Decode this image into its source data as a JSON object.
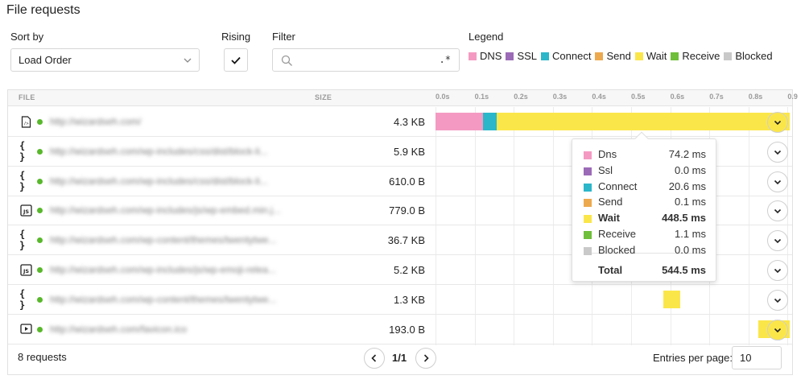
{
  "page": {
    "title": "File requests"
  },
  "controls": {
    "sort_label": "Sort by",
    "sort_value": "Load Order",
    "rising_label": "Rising",
    "filter_label": "Filter",
    "filter_value": "",
    "regex_glyph": ".*",
    "legend_label": "Legend"
  },
  "legend": [
    {
      "name": "DNS",
      "color": "#f49ac2"
    },
    {
      "name": "SSL",
      "color": "#9b6bb7"
    },
    {
      "name": "Connect",
      "color": "#2bb6c9"
    },
    {
      "name": "Send",
      "color": "#eda94e"
    },
    {
      "name": "Wait",
      "color": "#fbe64a"
    },
    {
      "name": "Receive",
      "color": "#6fbf3a"
    },
    {
      "name": "Blocked",
      "color": "#c9c9c9"
    }
  ],
  "table": {
    "col_file": "FILE",
    "col_size": "SIZE",
    "ticks": [
      "0.0s",
      "0.1s",
      "0.2s",
      "0.3s",
      "0.4s",
      "0.5s",
      "0.6s",
      "0.7s",
      "0.8s",
      "0.9"
    ],
    "rows": [
      {
        "icon": "document-code-icon",
        "status": "green",
        "url": "http://wizardseh.com/",
        "size": "4.3 KB",
        "segments": [
          {
            "phase": "DNS",
            "start": 0.0,
            "end": 0.122
          },
          {
            "phase": "Connect",
            "start": 0.122,
            "end": 0.157
          },
          {
            "phase": "Wait",
            "start": 0.157,
            "end": 0.905
          }
        ],
        "expanded": true
      },
      {
        "icon": "braces-icon",
        "status": "green",
        "url": "http://wizardseh.com/wp-includes/css/dist/block-li...",
        "size": "5.9 KB",
        "segments": [],
        "expanded": false
      },
      {
        "icon": "braces-icon",
        "status": "green",
        "url": "http://wizardseh.com/wp-includes/css/dist/block-li...",
        "size": "610.0 B",
        "segments": [],
        "expanded": false
      },
      {
        "icon": "js-file-icon",
        "status": "green",
        "url": "http://wizardseh.com/wp-includes/js/wp-embed.min.j...",
        "size": "779.0 B",
        "segments": [],
        "expanded": false
      },
      {
        "icon": "braces-icon",
        "status": "green",
        "url": "http://wizardseh.com/wp-content/themes/twentytwe...",
        "size": "36.7 KB",
        "segments": [],
        "expanded": false
      },
      {
        "icon": "js-file-icon",
        "status": "green",
        "url": "http://wizardseh.com/wp-includes/js/wp-emoji-relea...",
        "size": "5.2 KB",
        "segments": [],
        "expanded": false
      },
      {
        "icon": "braces-icon",
        "status": "green",
        "url": "http://wizardseh.com/wp-content/themes/twentytwe...",
        "size": "1.3 KB",
        "segments": [
          {
            "phase": "Wait",
            "start": 0.583,
            "end": 0.626
          }
        ],
        "expanded": false
      },
      {
        "icon": "media-play-icon",
        "status": "green",
        "url": "http://wizardseh.com/favicon.ico",
        "size": "193.0 B",
        "segments": [
          {
            "phase": "Wait",
            "start": 0.826,
            "end": 0.905
          }
        ],
        "expanded": true
      }
    ]
  },
  "tooltip": {
    "rows": [
      {
        "name": "Dns",
        "value": "74.2 ms",
        "color": "#f49ac2",
        "bold": false
      },
      {
        "name": "Ssl",
        "value": "0.0 ms",
        "color": "#9b6bb7",
        "bold": false
      },
      {
        "name": "Connect",
        "value": "20.6 ms",
        "color": "#2bb6c9",
        "bold": false
      },
      {
        "name": "Send",
        "value": "0.1 ms",
        "color": "#eda94e",
        "bold": false
      },
      {
        "name": "Wait",
        "value": "448.5 ms",
        "color": "#fbe64a",
        "bold": true
      },
      {
        "name": "Receive",
        "value": "1.1 ms",
        "color": "#6fbf3a",
        "bold": false
      },
      {
        "name": "Blocked",
        "value": "0.0 ms",
        "color": "#c9c9c9",
        "bold": false
      }
    ],
    "total_label": "Total",
    "total_value": "544.5 ms"
  },
  "footer": {
    "count": "8 requests",
    "page": "1/1",
    "entries_label": "Entries per page:",
    "entries_value": "10"
  }
}
